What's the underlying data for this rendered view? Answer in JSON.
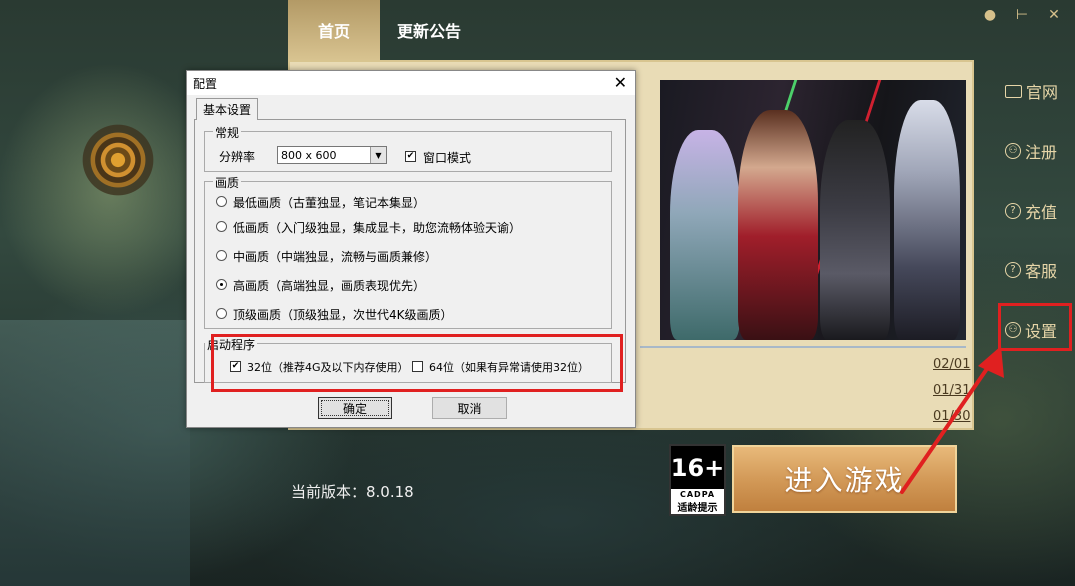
{
  "nav": {
    "home": "首页",
    "notice": "更新公告"
  },
  "top_icons": [
    "settings-dot-icon",
    "minimize-icon",
    "close-tools-icon"
  ],
  "sidebar": {
    "items": [
      {
        "label": "官网",
        "icon": "monitor-icon"
      },
      {
        "label": "注册",
        "icon": "user-icon"
      },
      {
        "label": "充值",
        "icon": "question-icon"
      },
      {
        "label": "客服",
        "icon": "question-icon"
      },
      {
        "label": "设置",
        "icon": "user-icon"
      }
    ]
  },
  "news": {
    "dates": [
      "02/01",
      "01/31",
      "01/30"
    ]
  },
  "version": "当前版本：8.0.18",
  "age_rating": {
    "age": "16+",
    "org": "CADPA",
    "tip": "适龄提示"
  },
  "start_button": "进入游戏",
  "dialog": {
    "title": "配置",
    "tab": "基本设置",
    "groups": {
      "normal": "常规",
      "quality": "画质",
      "launch": "启动程序"
    },
    "resolution_label": "分辨率",
    "resolution_value": "800 x 600",
    "window_mode_label": "窗口模式",
    "window_mode_checked": true,
    "quality_options": [
      "最低画质（古董独显，笔记本集显）",
      "低画质（入门级独显，集成显卡，助您流畅体验天谕）",
      "中画质（中端独显，流畅与画质兼修）",
      "高画质（高端独显，画质表现优先）",
      "顶级画质（顶级独显，次世代4K级画质）"
    ],
    "quality_selected": 3,
    "launch_options": [
      {
        "label": "32位（推荐4G及以下内存使用）",
        "checked": true
      },
      {
        "label": "64位（如果有异常请使用32位）",
        "checked": false
      }
    ],
    "ok": "确定",
    "cancel": "取消"
  },
  "colors": {
    "accent_gold": "#d8c390",
    "highlight_red": "#e02020",
    "start_btn": "#d39a58"
  }
}
